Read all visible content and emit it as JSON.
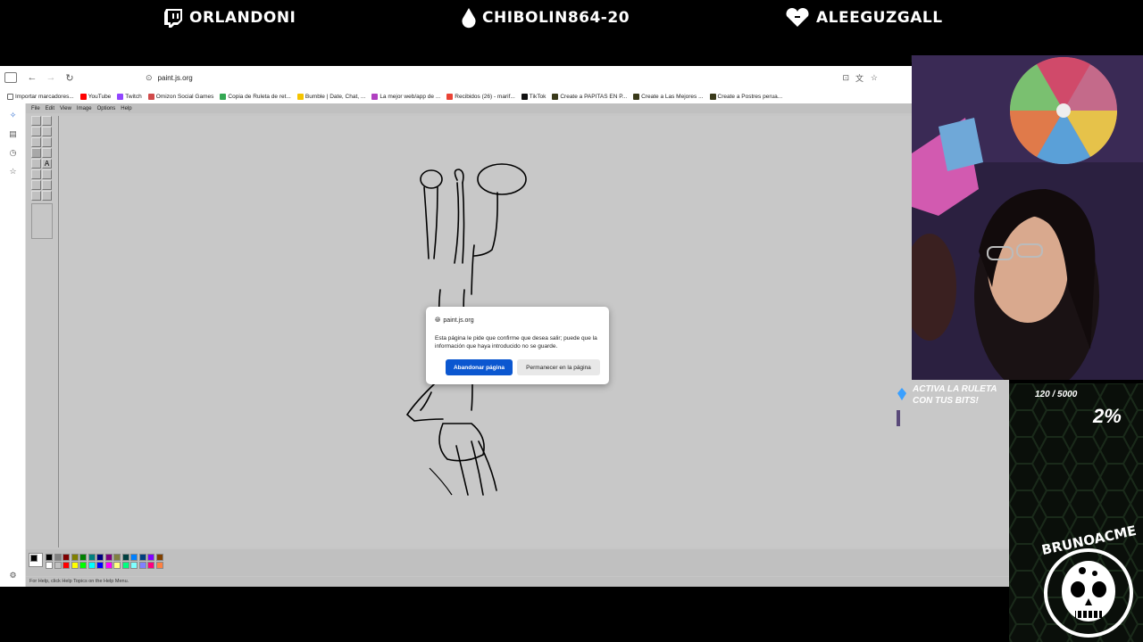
{
  "overlay": {
    "handles": [
      {
        "platform_icon": "twitch-icon",
        "name": "ORLANDONI"
      },
      {
        "platform_icon": "kick-drop-icon",
        "name": "CHIBOLIN864-20"
      },
      {
        "platform_icon": "heart-icon",
        "name": "ALEEGUZGALL"
      }
    ],
    "bits_goal": {
      "label": "ACTIVA LA RULETA CON TUS BITS!",
      "count": "120 / 5000",
      "percent": "2%",
      "progress_fraction": 0.02
    },
    "logo_text": "BRUNOACME"
  },
  "browser": {
    "url": "paint.js.org",
    "bookmarks": [
      {
        "label": "Importar marcadores...",
        "color": "#666666"
      },
      {
        "label": "YouTube",
        "color": "#ff0000"
      },
      {
        "label": "Twitch",
        "color": "#9146ff"
      },
      {
        "label": "Omizon Social Games",
        "color": "#d04a4a"
      },
      {
        "label": "Copia de Ruleta de ret...",
        "color": "#34a853"
      },
      {
        "label": "Bumble | Date, Chat, ...",
        "color": "#f5c400"
      },
      {
        "label": "La mejor web/app de ...",
        "color": "#b040c0"
      },
      {
        "label": "Recibidos (26) - marif...",
        "color": "#ea4335"
      },
      {
        "label": "TikTok",
        "color": "#111111"
      },
      {
        "label": "Create a PAPITAS EN P...",
        "color": "#3a3a1a"
      },
      {
        "label": "Create a Las Mejores ...",
        "color": "#3a3a1a"
      },
      {
        "label": "Create a Postres perua...",
        "color": "#3a3a1a"
      }
    ]
  },
  "paint": {
    "menu": [
      "File",
      "Edit",
      "View",
      "Image",
      "Options",
      "Help"
    ],
    "status": "For Help, click Help Topics on the Help Menu."
  },
  "dialog": {
    "site": "paint.js.org",
    "message": "Esta página le pide que confirme que desea salir; puede que la información que haya introducido no se guarde.",
    "leave_label": "Abandonar página",
    "stay_label": "Permanecer en la página"
  }
}
